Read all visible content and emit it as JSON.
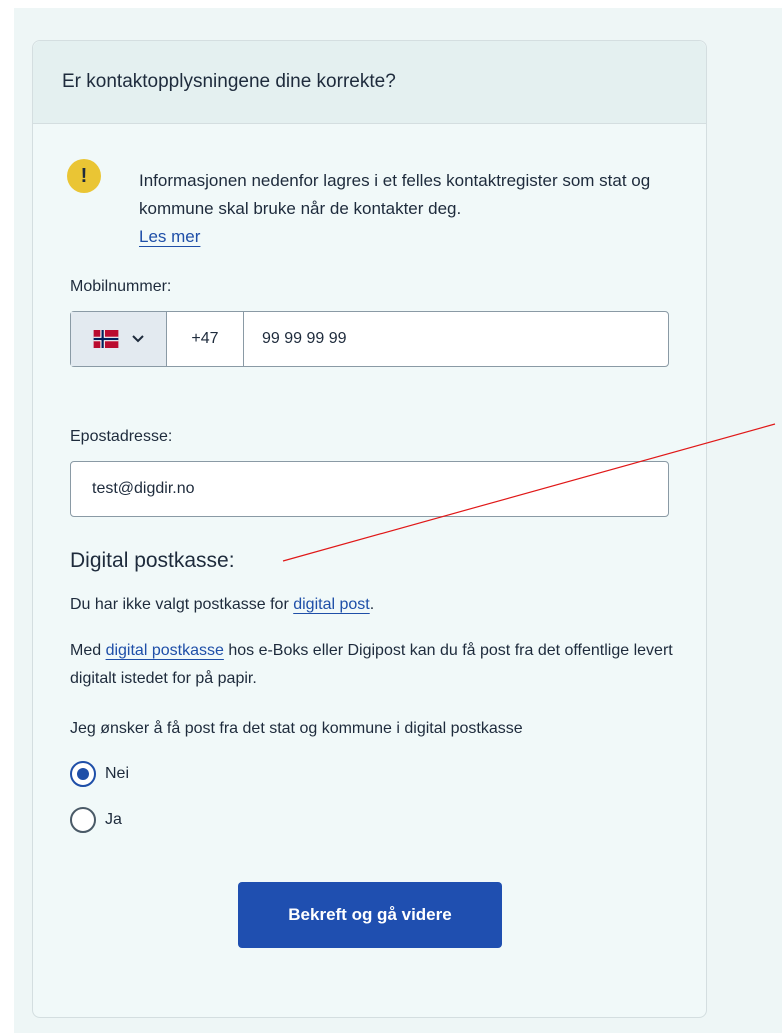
{
  "card": {
    "title": "Er kontaktopplysningene dine korrekte?"
  },
  "info": {
    "icon": "exclamation-icon",
    "text": "Informasjonen nedenfor lagres i et felles kontaktregister som stat og kommune skal bruke når de kontakter deg.",
    "link": "Les mer",
    "icon_glyph": "!"
  },
  "phone": {
    "label": "Mobilnummer:",
    "country": "Norway",
    "prefix": "+47",
    "value": "99 99 99 99"
  },
  "email": {
    "label": "Epostadresse:",
    "value": "test@digdir.no"
  },
  "postbox": {
    "title": "Digital postkasse:",
    "para1_before": "Du har ikke valgt postkasse for ",
    "para1_link": "digital post",
    "para1_after": ".",
    "para2_before": "Med ",
    "para2_link": "digital postkasse",
    "para2_after": " hos e-Boks eller Digipost kan du få post fra det offentlige levert digitalt istedet for på papir.",
    "question": "Jeg ønsker å få post fra det stat og kommune i digital postkasse",
    "options": [
      {
        "label": "Nei",
        "checked": true
      },
      {
        "label": "Ja",
        "checked": false
      }
    ]
  },
  "submit": {
    "label": "Bekreft og gå videre"
  },
  "colors": {
    "primary": "#1f4fb0",
    "warning": "#eac534",
    "annotation_line": "#e01818"
  }
}
